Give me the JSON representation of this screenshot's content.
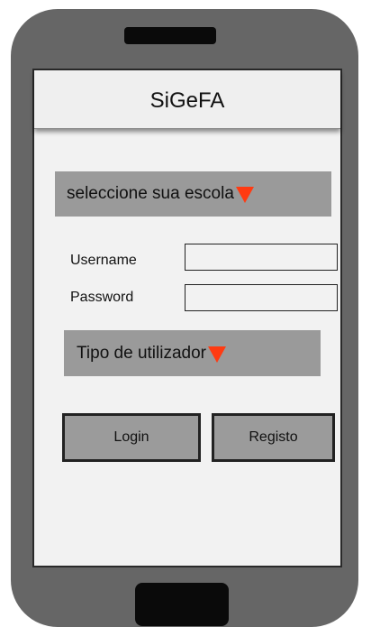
{
  "app": {
    "title": "SiGeFA"
  },
  "school_select": {
    "label": "seleccione sua escola"
  },
  "login_form": {
    "username_label": "Username",
    "username_value": "",
    "password_label": "Password",
    "password_value": ""
  },
  "user_type_select": {
    "label": "Tipo de utilizador"
  },
  "actions": {
    "login_label": "Login",
    "register_label": "Registo"
  },
  "icons": {
    "dropdown_arrow": "triangle-down-icon"
  },
  "colors": {
    "phone_body": "#666666",
    "screen_bg": "#f2f2f2",
    "dropdown_bg": "#9a9a9a",
    "button_bg": "#9b9b9b",
    "arrow": "#ff3b12"
  }
}
